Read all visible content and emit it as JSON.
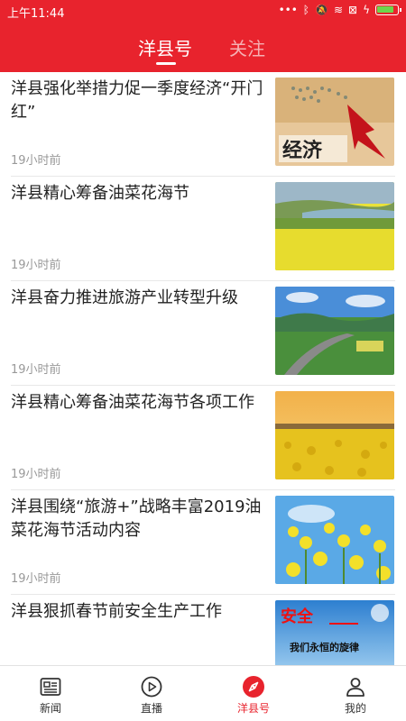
{
  "status_bar": {
    "time": "上午11:44",
    "icons": [
      "dots-icon",
      "bluetooth-icon",
      "mute-icon",
      "wifi-icon",
      "sim-icon",
      "charging-icon",
      "battery-icon"
    ]
  },
  "header": {
    "tabs": [
      {
        "label": "洋县号",
        "active": true
      },
      {
        "label": "关注",
        "active": false
      }
    ],
    "accent_color": "#e8232d"
  },
  "articles": [
    {
      "title": "洋县强化举措力促一季度经济“开门红”",
      "time": "19小时前"
    },
    {
      "title": "洋县精心筹备油菜花海节",
      "time": "19小时前"
    },
    {
      "title": "洋县奋力推进旅游产业转型升级",
      "time": "19小时前"
    },
    {
      "title": "洋县精心筹备油菜花海节各项工作",
      "time": "19小时前"
    },
    {
      "title": "洋县围绕“旅游+”战略丰富2019油菜花海节活动内容",
      "time": "19小时前"
    },
    {
      "title": "洋县狠抓春节前安全生产工作",
      "time": ""
    }
  ],
  "thumb6_text": {
    "line1": "安全",
    "line2": "我们永恒的旋律"
  },
  "bottom_nav": [
    {
      "label": "新闻",
      "icon": "newspaper-icon",
      "active": false
    },
    {
      "label": "直播",
      "icon": "play-icon",
      "active": false
    },
    {
      "label": "洋县号",
      "icon": "compass-icon",
      "active": true
    },
    {
      "label": "我的",
      "icon": "person-icon",
      "active": false
    }
  ]
}
